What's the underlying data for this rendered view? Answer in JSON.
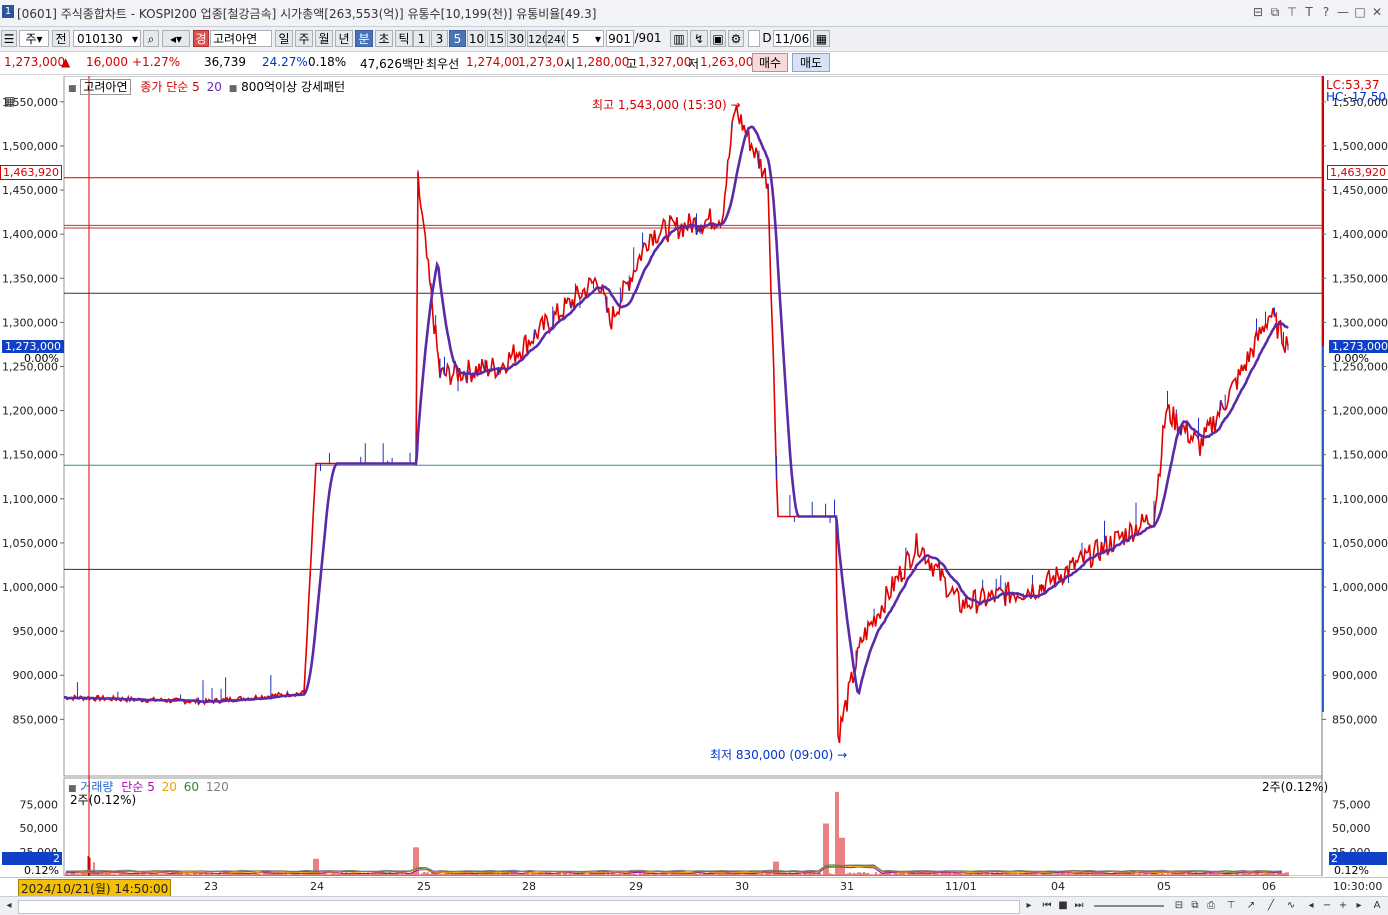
{
  "window": {
    "number": "1",
    "title": "[0601] 주식종합차트 - KOSPI200 업종[철강금속] 시가총액[263,553(억)] 유통수[10,199(천)] 유통비율[49.3]",
    "controls": [
      "⊟",
      "⧉",
      "⊤",
      "T",
      "?",
      "—",
      "□",
      "✕"
    ]
  },
  "toolbar": {
    "period_unit": "주",
    "scope": "전",
    "code": "010130",
    "market_badge": "경",
    "stock_name": "고려아연",
    "periods": [
      "일",
      "주",
      "월",
      "년",
      "분",
      "초",
      "틱"
    ],
    "selected_period": "분",
    "intervals": [
      "1",
      "3",
      "5",
      "10",
      "15",
      "30",
      "120",
      "240"
    ],
    "selected_interval": "5",
    "count_select": "5",
    "count": "901",
    "count_total": "/901",
    "d_label": "D",
    "date": "11/06"
  },
  "quote": {
    "price": "1,273,000",
    "arrow": "▲",
    "change": "16,000",
    "change_pct": "+1.27%",
    "volume": "36,739",
    "ratio": "24.27%",
    "ratio2": "0.18%",
    "amount": "47,626백만",
    "best_label": "최우선",
    "ask": "1,274,00",
    "bid": "1,273,0",
    "open_label": "시",
    "open": "1,280,00",
    "high_label": "고",
    "high": "1,327,00",
    "low_label": "저",
    "low": "1,263,00",
    "buy_label": "매수",
    "sell_label": "매도"
  },
  "chart_legend": {
    "stock": "고려아연",
    "ma_label": "종가 단순 5",
    "ma2": "20",
    "pattern": "800억이상 강세패턴",
    "lc": "LC:53,37",
    "hc": "HC:-17,50",
    "pct_left": "0.00%",
    "pct_right": "0.00%"
  },
  "annotations": {
    "high_text": "최고 1,543,000 (15:30)",
    "low_text": "최저 830,000 (09:00)",
    "hline_red_value": "1,463,920",
    "current_value": "1,273,000"
  },
  "volume_panel": {
    "title": "거래량",
    "ma_label": "단순 5",
    "ma20": "20",
    "ma60": "60",
    "ma120": "120",
    "info_left": "2주(0.12%)",
    "info_right": "2주(0.12%)",
    "badge": "2",
    "badge_pct": "0.12%",
    "colors": {
      "ma5": "#b000b0",
      "ma20": "#e8a000",
      "ma60": "#2a8a2a",
      "ma120": "#808080"
    }
  },
  "x_axis": {
    "cursor_label": "2024/10/21(월) 14:50:00",
    "labels": [
      "23",
      "24",
      "25",
      "28",
      "29",
      "30",
      "31",
      "11/01",
      "04",
      "05",
      "06"
    ],
    "time_right": "10:30:00"
  },
  "chart_data": {
    "type": "line",
    "series": [],
    "y_ticks": [
      "1,550,000",
      "1,500,000",
      "1,450,000",
      "1,400,000",
      "1,350,000",
      "1,300,000",
      "1,250,000",
      "1,200,000",
      "1,150,000",
      "1,100,000",
      "1,050,000",
      "1,000,000",
      "950,000",
      "900,000",
      "850,000"
    ],
    "ylim": [
      830000,
      1560000
    ],
    "volume_ticks": [
      "75,000",
      "50,000",
      "25,000"
    ],
    "key_points": [
      {
        "x": "23",
        "y": 875000
      },
      {
        "x": "24",
        "y": 880000
      },
      {
        "x": "24",
        "y": 1140000
      },
      {
        "x": "25",
        "y": 1140000
      },
      {
        "x": "25",
        "y": 1460000
      },
      {
        "x": "25",
        "y": 1240000
      },
      {
        "x": "28",
        "y": 1250000
      },
      {
        "x": "29",
        "y": 1360000
      },
      {
        "x": "29",
        "y": 1300000
      },
      {
        "x": "29",
        "y": 1400000
      },
      {
        "x": "30",
        "y": 1420000
      },
      {
        "x": "30",
        "y": 1543000
      },
      {
        "x": "30",
        "y": 1460000
      },
      {
        "x": "30",
        "y": 1080000
      },
      {
        "x": "31",
        "y": 1080000
      },
      {
        "x": "31",
        "y": 830000
      },
      {
        "x": "31",
        "y": 940000
      },
      {
        "x": "11/01",
        "y": 1050000
      },
      {
        "x": "11/01",
        "y": 980000
      },
      {
        "x": "04",
        "y": 1000000
      },
      {
        "x": "05",
        "y": 1080000
      },
      {
        "x": "05",
        "y": 1200000
      },
      {
        "x": "05",
        "y": 1160000
      },
      {
        "x": "06",
        "y": 1240000
      },
      {
        "x": "06",
        "y": 1310000
      },
      {
        "x": "06",
        "y": 1273000
      }
    ],
    "hlines": [
      1463920,
      1410000,
      1407000,
      1333000,
      1138000,
      1020000
    ]
  }
}
